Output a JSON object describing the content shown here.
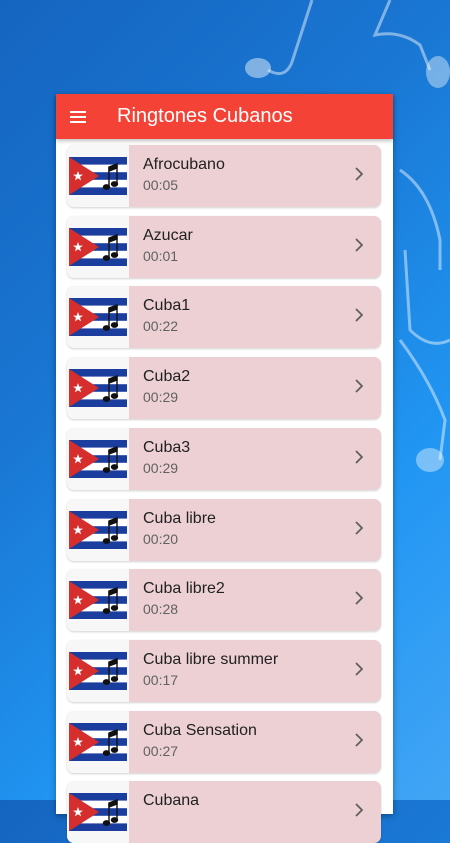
{
  "app": {
    "title": "Ringtones Cubanos"
  },
  "icons": {
    "menu": "menu-icon",
    "chevron": "chevron-right-icon",
    "thumb": "cuba-flag-music-note-icon"
  },
  "colors": {
    "appbar": "#f44336",
    "item_bg": "#ecd0d4",
    "background": "#1e88e5"
  },
  "ringtones": [
    {
      "name": "Afrocubano",
      "duration": "00:05"
    },
    {
      "name": "Azucar",
      "duration": "00:01"
    },
    {
      "name": "Cuba1",
      "duration": "00:22"
    },
    {
      "name": "Cuba2",
      "duration": "00:29"
    },
    {
      "name": "Cuba3",
      "duration": "00:29"
    },
    {
      "name": "Cuba libre",
      "duration": "00:20"
    },
    {
      "name": "Cuba libre2",
      "duration": "00:28"
    },
    {
      "name": "Cuba libre summer",
      "duration": "00:17"
    },
    {
      "name": "Cuba Sensation",
      "duration": "00:27"
    },
    {
      "name": "Cubana",
      "duration": ""
    }
  ]
}
